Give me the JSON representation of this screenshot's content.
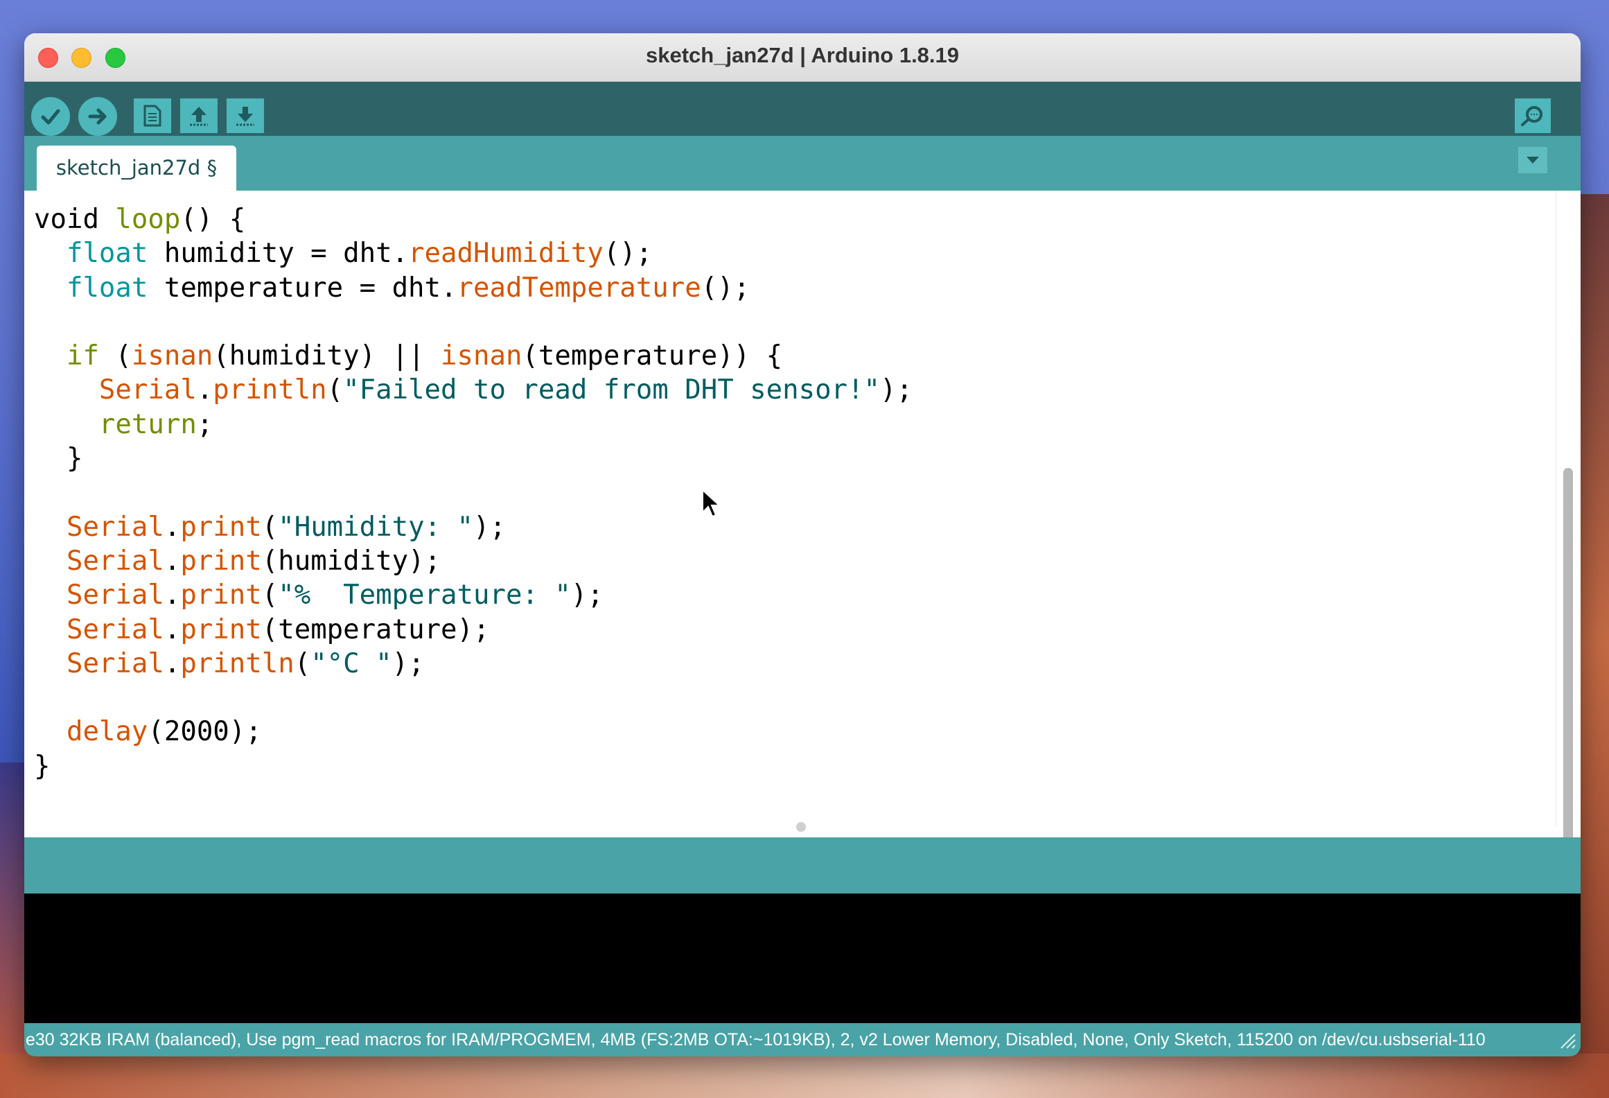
{
  "window": {
    "title": "sketch_jan27d | Arduino 1.8.19"
  },
  "toolbar": {
    "buttons": [
      {
        "name": "verify-icon"
      },
      {
        "name": "upload-icon"
      },
      {
        "name": "new-icon"
      },
      {
        "name": "open-icon"
      },
      {
        "name": "save-icon"
      },
      {
        "name": "serial-monitor-icon"
      }
    ]
  },
  "tabs": [
    {
      "label": "sketch_jan27d §"
    }
  ],
  "editor": {
    "lines": [
      "void loop() {",
      "  float humidity = dht.readHumidity();",
      "  float temperature = dht.readTemperature();",
      "",
      "  if (isnan(humidity) || isnan(temperature)) {",
      "    Serial.println(\"Failed to read from DHT sensor!\");",
      "    return;",
      "  }",
      "",
      "  Serial.print(\"Humidity: \");",
      "  Serial.print(humidity);",
      "  Serial.print(\"%  Temperature: \");",
      "  Serial.print(temperature);",
      "  Serial.println(\"°C \");",
      "",
      "  delay(2000);",
      "}"
    ]
  },
  "statusbar": {
    "text": "e30 32KB IRAM (balanced), Use pgm_read macros for IRAM/PROGMEM, 4MB (FS:2MB OTA:~1019KB), 2, v2 Lower Memory, Disabled, None, Only Sketch, 115200 on /dev/cu.usbserial-110"
  },
  "colors": {
    "toolbar": "#2e6468",
    "tabstrip": "#4aa3a6",
    "button": "#4db7bb",
    "keyword": "#00979c",
    "function": "#d35400",
    "string": "#005c5f"
  }
}
